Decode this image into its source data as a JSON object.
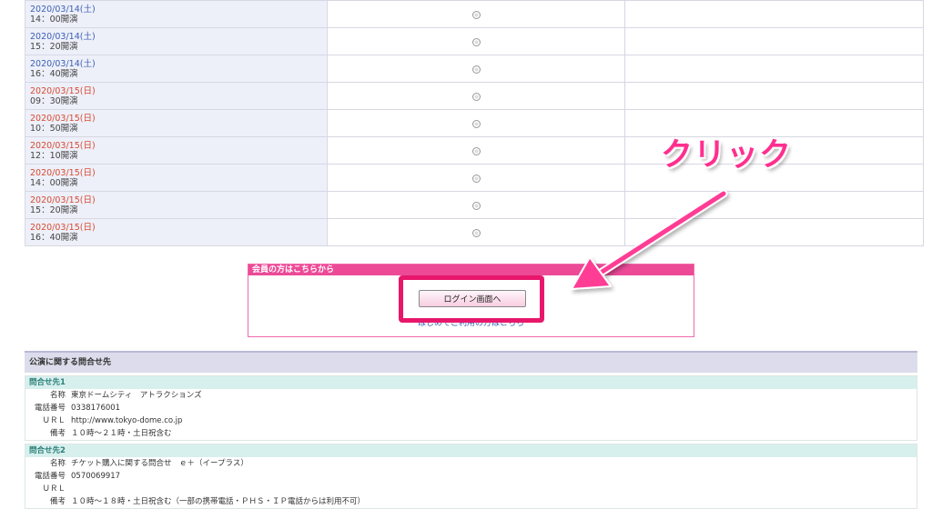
{
  "performances": [
    {
      "date": "2020/03/14(土)",
      "time": "14：00開演",
      "day": "sat",
      "availability_icon": "available-circle-icon"
    },
    {
      "date": "2020/03/14(土)",
      "time": "15：20開演",
      "day": "sat",
      "availability_icon": "available-circle-icon"
    },
    {
      "date": "2020/03/14(土)",
      "time": "16：40開演",
      "day": "sat",
      "availability_icon": "available-circle-icon"
    },
    {
      "date": "2020/03/15(日)",
      "time": "09：30開演",
      "day": "sun",
      "availability_icon": "available-circle-icon"
    },
    {
      "date": "2020/03/15(日)",
      "time": "10：50開演",
      "day": "sun",
      "availability_icon": "available-circle-icon"
    },
    {
      "date": "2020/03/15(日)",
      "time": "12：10開演",
      "day": "sun",
      "availability_icon": "available-circle-icon"
    },
    {
      "date": "2020/03/15(日)",
      "time": "14：00開演",
      "day": "sun",
      "availability_icon": "available-circle-icon"
    },
    {
      "date": "2020/03/15(日)",
      "time": "15：20開演",
      "day": "sun",
      "availability_icon": "available-circle-icon"
    },
    {
      "date": "2020/03/15(日)",
      "time": "16：40開演",
      "day": "sun",
      "availability_icon": "available-circle-icon"
    }
  ],
  "member": {
    "header": "会員の方はこちらから",
    "login_button": "ログイン画面へ",
    "first_time_link": "はじめてご利用の方はこちら"
  },
  "annotation": {
    "click_label": "クリック"
  },
  "contact": {
    "header": "公演に関する問合せ先",
    "blocks": [
      {
        "title": "問合せ先1",
        "rows": [
          {
            "label": "名称",
            "value": "東京ドームシティ　アトラクションズ"
          },
          {
            "label": "電話番号",
            "value": "0338176001"
          },
          {
            "label": "ＵＲＬ",
            "value": "http://www.tokyo-dome.co.jp"
          },
          {
            "label": "備考",
            "value": "１０時〜２１時・土日祝含む"
          }
        ]
      },
      {
        "title": "問合せ先2",
        "rows": [
          {
            "label": "名称",
            "value": "チケット購入に関する問合せ　ｅ＋（イープラス）"
          },
          {
            "label": "電話番号",
            "value": "0570069917"
          },
          {
            "label": "ＵＲＬ",
            "value": ""
          },
          {
            "label": "備考",
            "value": "１０時〜１８時・土日祝含む（一部の携帯電話・ＰＨＳ・ＩＰ電話からは利用不可）"
          }
        ]
      }
    ]
  },
  "colors": {
    "saturday": "#3a5fb4",
    "sunday": "#d64a33",
    "accent_pink": "#ec4a97",
    "highlight": "#e8176b"
  }
}
